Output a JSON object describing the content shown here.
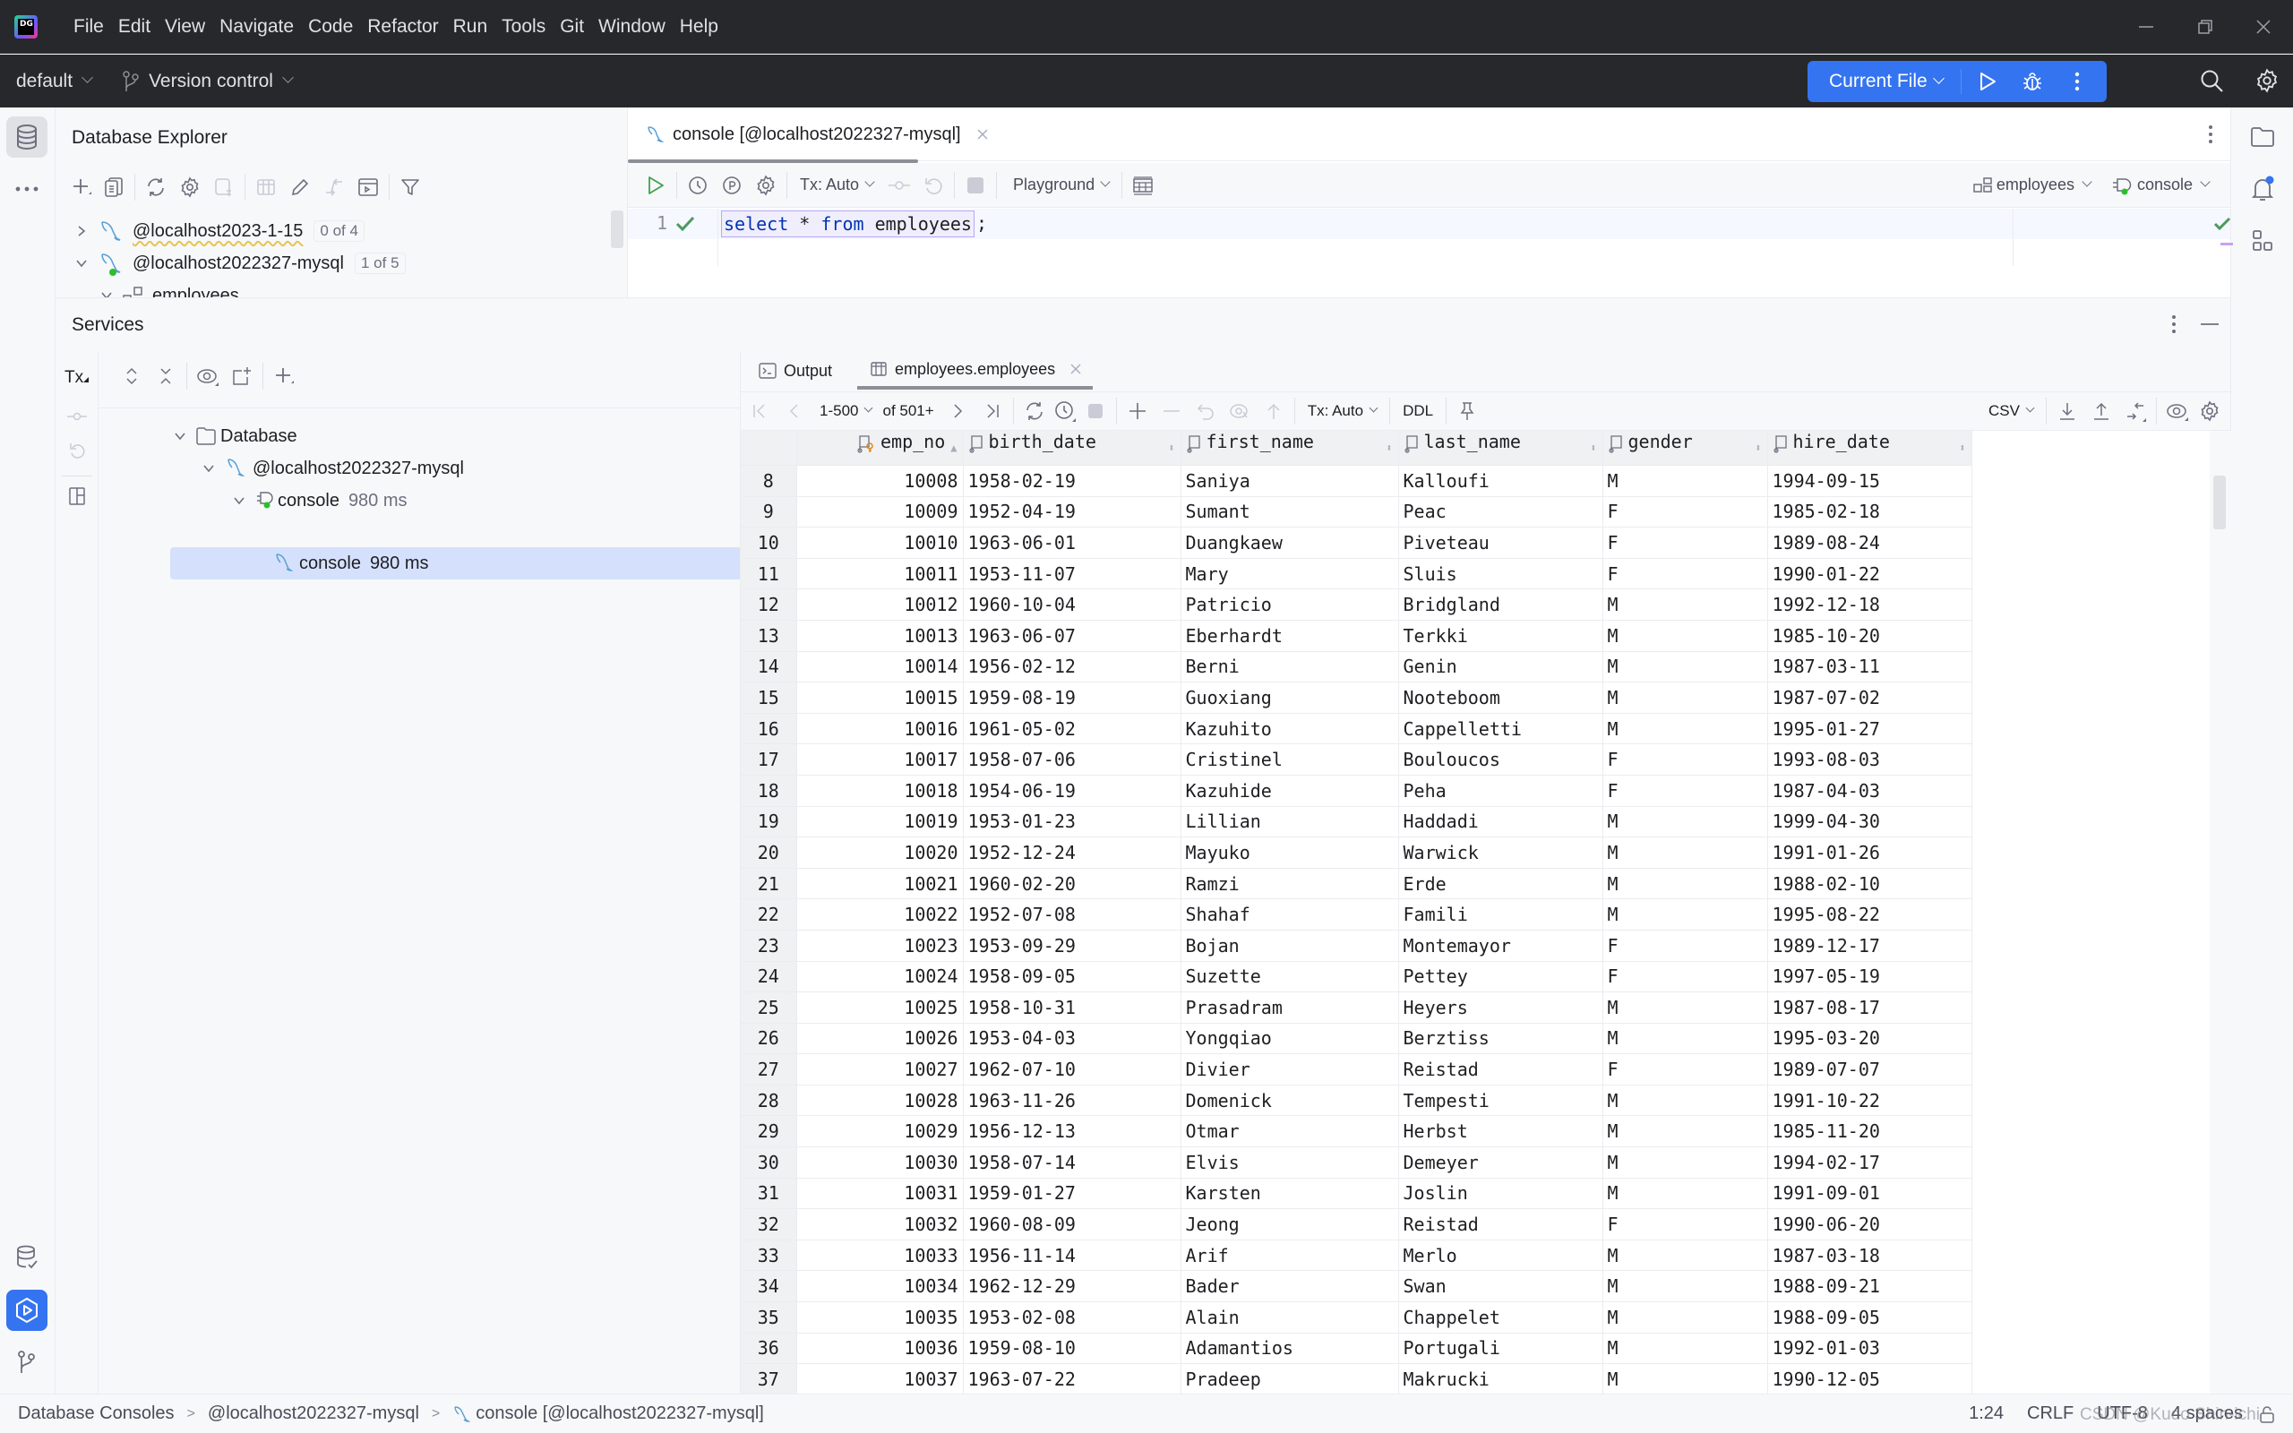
{
  "titlebar": {
    "app_logo": "DG",
    "menu": [
      "File",
      "Edit",
      "View",
      "Navigate",
      "Code",
      "Refactor",
      "Run",
      "Tools",
      "Git",
      "Window",
      "Help"
    ]
  },
  "toolbar": {
    "project": "default",
    "vcs": "Version control",
    "run_config": "Current File"
  },
  "db_explorer": {
    "title": "Database Explorer",
    "nodes": [
      {
        "label": "@localhost2023-1-15",
        "badge": "0 of 4",
        "expanded": false
      },
      {
        "label": "@localhost2022327-mysql",
        "badge": "1 of 5",
        "expanded": true
      },
      {
        "label": "employees",
        "badge": "",
        "expanded": true
      }
    ]
  },
  "editor": {
    "tab_label": "console [@localhost2022327-mysql]",
    "tx_mode": "Tx: Auto",
    "playground": "Playground",
    "schema": "employees",
    "session": "console",
    "line_number": "1",
    "code": {
      "kw1": "select",
      "star": " * ",
      "kw2": "from",
      "ident": " employees",
      "semi": ";"
    }
  },
  "services": {
    "title": "Services",
    "tx_label": "Tx",
    "tree": [
      {
        "label": "Database",
        "extra": ""
      },
      {
        "label": "@localhost2022327-mysql",
        "extra": ""
      },
      {
        "label": "console",
        "extra": "980 ms"
      },
      {
        "label": "console",
        "extra": "980 ms",
        "selected": true
      }
    ]
  },
  "results": {
    "tabs": [
      {
        "label": "Output"
      },
      {
        "label": "employees.employees",
        "active": true
      }
    ],
    "page_range": "1-500",
    "page_total": "of 501+",
    "tx_mode": "Tx: Auto",
    "ddl": "DDL",
    "export_format": "CSV",
    "columns": [
      "emp_no",
      "birth_date",
      "first_name",
      "last_name",
      "gender",
      "hire_date"
    ],
    "rows": [
      [
        "8",
        "10008",
        "1958-02-19",
        "Saniya",
        "Kalloufi",
        "M",
        "1994-09-15"
      ],
      [
        "9",
        "10009",
        "1952-04-19",
        "Sumant",
        "Peac",
        "F",
        "1985-02-18"
      ],
      [
        "10",
        "10010",
        "1963-06-01",
        "Duangkaew",
        "Piveteau",
        "F",
        "1989-08-24"
      ],
      [
        "11",
        "10011",
        "1953-11-07",
        "Mary",
        "Sluis",
        "F",
        "1990-01-22"
      ],
      [
        "12",
        "10012",
        "1960-10-04",
        "Patricio",
        "Bridgland",
        "M",
        "1992-12-18"
      ],
      [
        "13",
        "10013",
        "1963-06-07",
        "Eberhardt",
        "Terkki",
        "M",
        "1985-10-20"
      ],
      [
        "14",
        "10014",
        "1956-02-12",
        "Berni",
        "Genin",
        "M",
        "1987-03-11"
      ],
      [
        "15",
        "10015",
        "1959-08-19",
        "Guoxiang",
        "Nooteboom",
        "M",
        "1987-07-02"
      ],
      [
        "16",
        "10016",
        "1961-05-02",
        "Kazuhito",
        "Cappelletti",
        "M",
        "1995-01-27"
      ],
      [
        "17",
        "10017",
        "1958-07-06",
        "Cristinel",
        "Bouloucos",
        "F",
        "1993-08-03"
      ],
      [
        "18",
        "10018",
        "1954-06-19",
        "Kazuhide",
        "Peha",
        "F",
        "1987-04-03"
      ],
      [
        "19",
        "10019",
        "1953-01-23",
        "Lillian",
        "Haddadi",
        "M",
        "1999-04-30"
      ],
      [
        "20",
        "10020",
        "1952-12-24",
        "Mayuko",
        "Warwick",
        "M",
        "1991-01-26"
      ],
      [
        "21",
        "10021",
        "1960-02-20",
        "Ramzi",
        "Erde",
        "M",
        "1988-02-10"
      ],
      [
        "22",
        "10022",
        "1952-07-08",
        "Shahaf",
        "Famili",
        "M",
        "1995-08-22"
      ],
      [
        "23",
        "10023",
        "1953-09-29",
        "Bojan",
        "Montemayor",
        "F",
        "1989-12-17"
      ],
      [
        "24",
        "10024",
        "1958-09-05",
        "Suzette",
        "Pettey",
        "F",
        "1997-05-19"
      ],
      [
        "25",
        "10025",
        "1958-10-31",
        "Prasadram",
        "Heyers",
        "M",
        "1987-08-17"
      ],
      [
        "26",
        "10026",
        "1953-04-03",
        "Yongqiao",
        "Berztiss",
        "M",
        "1995-03-20"
      ],
      [
        "27",
        "10027",
        "1962-07-10",
        "Divier",
        "Reistad",
        "F",
        "1989-07-07"
      ],
      [
        "28",
        "10028",
        "1963-11-26",
        "Domenick",
        "Tempesti",
        "M",
        "1991-10-22"
      ],
      [
        "29",
        "10029",
        "1956-12-13",
        "Otmar",
        "Herbst",
        "M",
        "1985-11-20"
      ],
      [
        "30",
        "10030",
        "1958-07-14",
        "Elvis",
        "Demeyer",
        "M",
        "1994-02-17"
      ],
      [
        "31",
        "10031",
        "1959-01-27",
        "Karsten",
        "Joslin",
        "M",
        "1991-09-01"
      ],
      [
        "32",
        "10032",
        "1960-08-09",
        "Jeong",
        "Reistad",
        "F",
        "1990-06-20"
      ],
      [
        "33",
        "10033",
        "1956-11-14",
        "Arif",
        "Merlo",
        "M",
        "1987-03-18"
      ],
      [
        "34",
        "10034",
        "1962-12-29",
        "Bader",
        "Swan",
        "M",
        "1988-09-21"
      ],
      [
        "35",
        "10035",
        "1953-02-08",
        "Alain",
        "Chappelet",
        "M",
        "1988-09-05"
      ],
      [
        "36",
        "10036",
        "1959-08-10",
        "Adamantios",
        "Portugali",
        "M",
        "1992-01-03"
      ],
      [
        "37",
        "10037",
        "1963-07-22",
        "Pradeep",
        "Makrucki",
        "M",
        "1990-12-05"
      ]
    ]
  },
  "statusbar": {
    "breadcrumbs": [
      "Database Consoles",
      "@localhost2022327-mysql",
      "console [@localhost2022327-mysql]"
    ],
    "position": "1:24",
    "line_ending": "CRLF",
    "encoding": "UTF-8",
    "indent": "4 spaces",
    "watermark": "CSDN @Kudo Shin-ichi"
  },
  "colors": {
    "accent": "#3574f0",
    "dark_chrome": "#27282c",
    "selection": "#d5e1fc",
    "success": "#4a9b5e"
  }
}
